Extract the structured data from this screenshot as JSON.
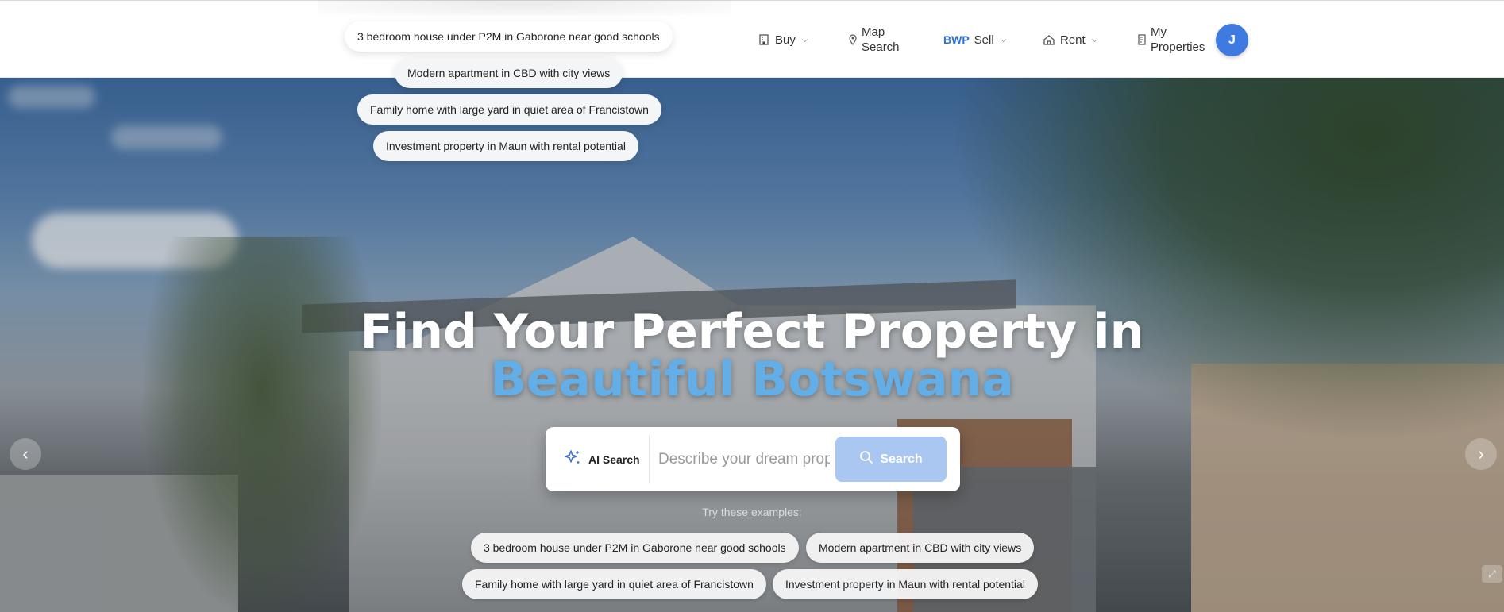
{
  "header": {
    "nav": {
      "buy": {
        "label": "Buy"
      },
      "map_search": {
        "line1": "Map",
        "line2": "Search"
      },
      "sell": {
        "currency": "BWP",
        "label": "Sell"
      },
      "rent": {
        "label": "Rent"
      },
      "my_properties": {
        "line1": "My",
        "line2": "Properties"
      }
    },
    "avatar_initial": "J"
  },
  "suggestion_dropdown": [
    "3 bedroom house under P2M in Gaborone near good schools",
    "Modern apartment in CBD with city views",
    "Family home with large yard in quiet area of Francistown",
    "Investment property in Maun with rental potential"
  ],
  "hero": {
    "title_line1": "Find Your Perfect Property in",
    "title_line2": "Beautiful Botswana",
    "search": {
      "ai_label": "AI Search",
      "placeholder": "Describe your dream property",
      "button_label": "Search"
    },
    "examples_label": "Try these examples:",
    "examples": [
      "3 bedroom house under P2M in Gaborone near good schools",
      "Modern apartment in CBD with city views",
      "Family home with large yard in quiet area of Francistown",
      "Investment property in Maun with rental potential"
    ]
  },
  "colors": {
    "accent": "#63aee6",
    "avatar": "#3f7ae0",
    "search_button": "#a9c7f0",
    "currency": "#2f6fdd"
  },
  "icons": [
    "building-icon",
    "map-pin-icon",
    "home-icon",
    "document-icon",
    "sparkle-icon",
    "search-icon",
    "chevron-left-icon",
    "chevron-right-icon"
  ]
}
